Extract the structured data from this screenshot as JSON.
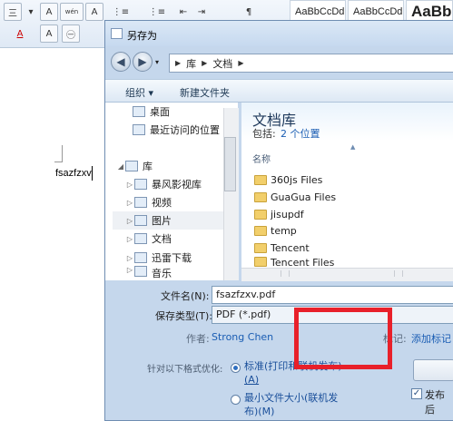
{
  "ribbon": {
    "row1": [
      "三",
      "A",
      "wén",
      "A",
      "⋮≡",
      "⋮≡",
      "⇤",
      "⇥",
      "¶"
    ],
    "row2_font_color_label": "A",
    "styles": [
      "AaBbCcDd",
      "AaBbCcDd",
      "AaBb"
    ]
  },
  "document": {
    "text": "fsazfzxv"
  },
  "dialog": {
    "title": "另存为",
    "breadcrumb": [
      "库",
      "文档"
    ],
    "toolbar": {
      "organize": "组织 ▾",
      "new_folder": "新建文件夹"
    },
    "nav_items": [
      {
        "label": "桌面",
        "icon": "desktop-icon",
        "expand": "",
        "selected": false
      },
      {
        "label": "最近访问的位置",
        "icon": "recent-places-icon",
        "expand": "",
        "selected": false
      },
      {
        "label": "库",
        "icon": "library-icon",
        "expand": "◢",
        "selected": false
      },
      {
        "label": "暴风影视库",
        "icon": "video-library-icon",
        "expand": "▷",
        "selected": false
      },
      {
        "label": "视频",
        "icon": "video-icon",
        "expand": "▷",
        "selected": false
      },
      {
        "label": "图片",
        "icon": "pictures-icon",
        "expand": "▷",
        "selected": true
      },
      {
        "label": "文档",
        "icon": "documents-icon",
        "expand": "▷",
        "selected": false
      },
      {
        "label": "迅雷下载",
        "icon": "download-icon",
        "expand": "▷",
        "selected": false
      },
      {
        "label": "音乐",
        "icon": "music-icon",
        "expand": "▷",
        "selected": false
      }
    ],
    "library": {
      "title": "文档库",
      "includes_label": "包括:",
      "locations_link": "2 个位置",
      "column_name": "名称"
    },
    "files": [
      "360js Files",
      "GuaGua Files",
      "jisupdf",
      "temp",
      "Tencent",
      "Tencent Files"
    ],
    "form": {
      "filename_label": "文件名(N):",
      "filename_value": "fsazfzxv.pdf",
      "filetype_label": "保存类型(T):",
      "filetype_value": "PDF (*.pdf)",
      "author_label": "作者:",
      "author_value": "Strong Chen",
      "tags_label": "标记:",
      "tags_value": "添加标记",
      "optimize_label": "针对以下格式优化:",
      "option_standard_line1": "标准(打印和联机发布)",
      "option_standard_line2": "(A)",
      "option_min_line1": "最小文件大小(联机发",
      "option_min_line2": "布)(M)",
      "publish_label": "发布后",
      "publish_checked": "✓"
    }
  },
  "colors": {
    "highlight": "#e8202a",
    "link": "#1a5db3"
  }
}
